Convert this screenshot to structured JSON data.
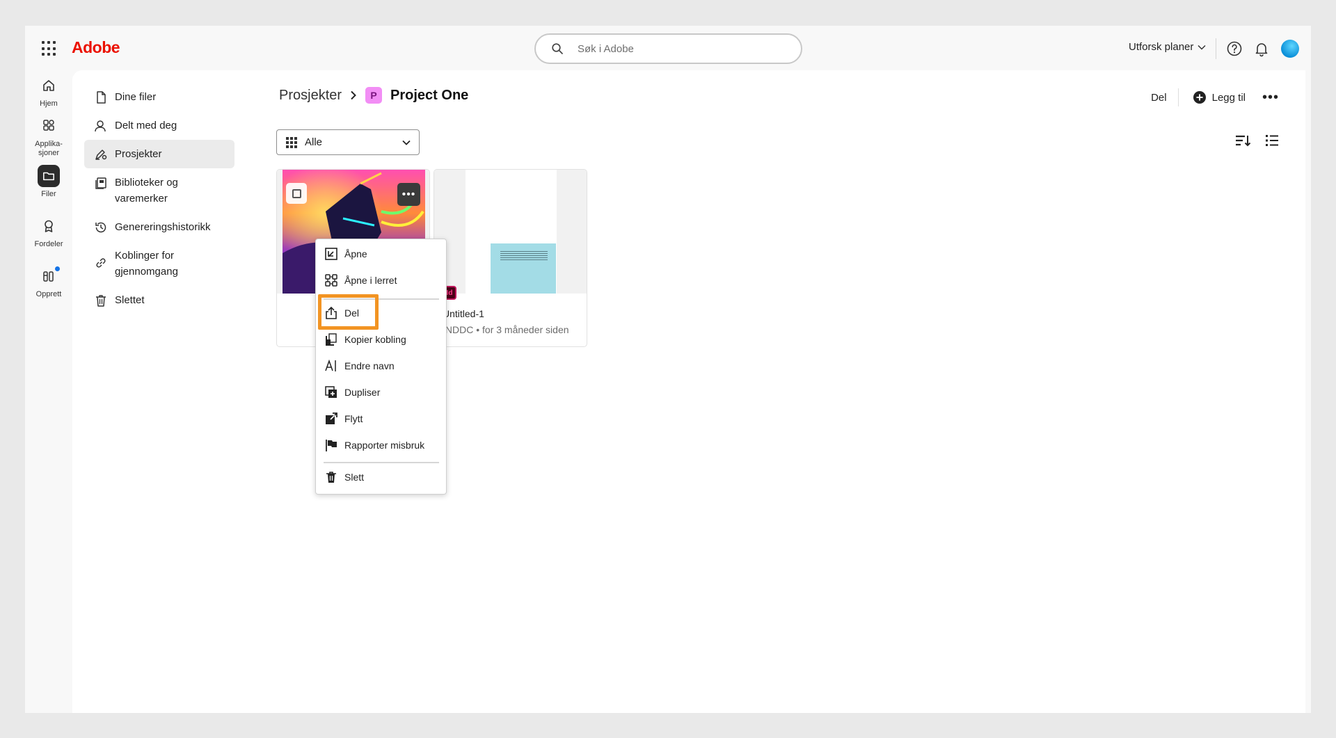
{
  "brand": {
    "logo": "Adobe",
    "accent": "#eb1000"
  },
  "search": {
    "placeholder": "Søk i Adobe"
  },
  "topbar": {
    "explore_label": "Utforsk planer"
  },
  "rail": {
    "home": "Hjem",
    "apps_line1": "Applika-",
    "apps_line2": "sjoner",
    "files": "Filer",
    "benefits": "Fordeler",
    "create": "Opprett"
  },
  "sidenav": {
    "your_files": "Dine filer",
    "shared": "Delt med deg",
    "projects": "Prosjekter",
    "libraries": "Biblioteker og varemerker",
    "history": "Genereringshistorikk",
    "review_line1": "Koblinger for",
    "review_line2": "gjennomgang",
    "deleted": "Slettet"
  },
  "breadcrumb": {
    "parent": "Prosjekter",
    "badge": "P",
    "current": "Project One"
  },
  "header": {
    "share": "Del",
    "add": "Legg til"
  },
  "filter": {
    "selected": "Alle"
  },
  "cards": [
    {
      "title": "Untitled-1",
      "meta": "INDDC • for 3 måneder siden",
      "badge": "Id"
    }
  ],
  "menu": {
    "open": "Åpne",
    "open_canvas": "Åpne i lerret",
    "share": "Del",
    "copy_link": "Kopier kobling",
    "rename": "Endre navn",
    "duplicate": "Dupliser",
    "move": "Flytt",
    "report": "Rapporter misbruk",
    "delete": "Slett"
  },
  "highlight_color": "#f29423"
}
